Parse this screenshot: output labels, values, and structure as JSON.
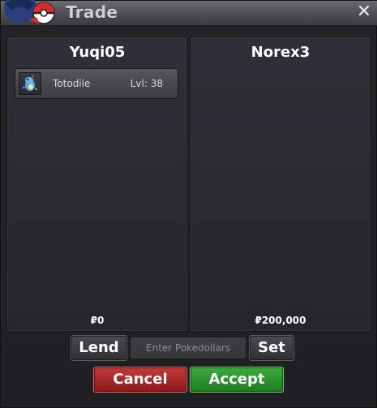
{
  "window": {
    "title": "Trade",
    "close_glyph": "✕",
    "logo_icon": "pokeball-icon"
  },
  "left_panel": {
    "player_name": "Yuqi05",
    "offer": [
      {
        "pokemon": "Totodile",
        "level": "Lvl: 38",
        "icon": "totodile-sprite-icon"
      }
    ],
    "money": "₽0"
  },
  "right_panel": {
    "player_name": "Norex3",
    "offer": [],
    "money": "₽200,000"
  },
  "controls": {
    "lend_label": "Lend",
    "money_placeholder": "Enter Pokedollars",
    "set_label": "Set",
    "cancel_label": "Cancel",
    "accept_label": "Accept"
  },
  "colors": {
    "cancel": "#a82424",
    "accept": "#2e962e",
    "panel_bg": "#2b2b32"
  }
}
